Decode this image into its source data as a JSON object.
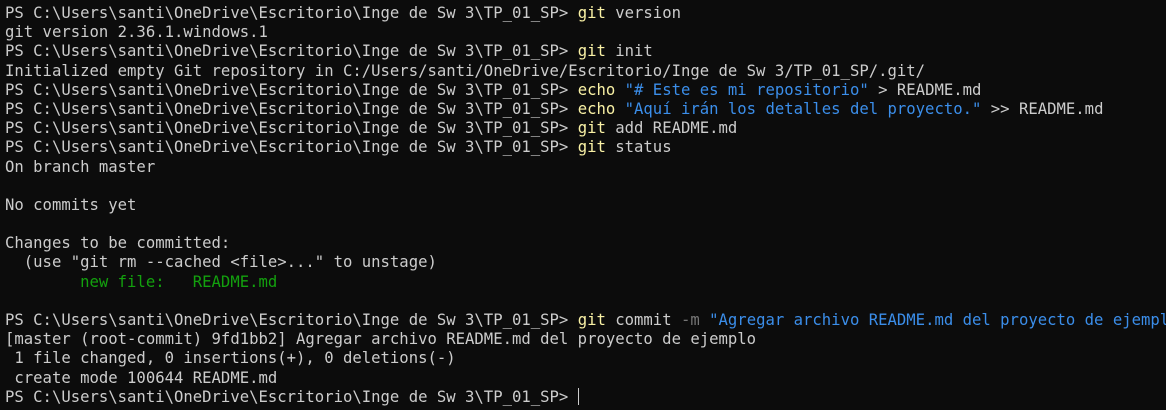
{
  "prompt": "PS C:\\Users\\santi\\OneDrive\\Escritorio\\Inge de Sw 3\\TP_01_SP> ",
  "lines": {
    "l1": {
      "cmd": "git",
      "arg": " version"
    },
    "l2": "git version 2.36.1.windows.1",
    "l3": {
      "cmd": "git",
      "arg": " init"
    },
    "l4": "Initialized empty Git repository in C:/Users/santi/OneDrive/Escritorio/Inge de Sw 3/TP_01_SP/.git/",
    "l5": {
      "cmd": "echo",
      "str": " \"# Este es mi repositorio\"",
      "rest": " > README.md"
    },
    "l6": {
      "cmd": "echo",
      "str": " \"Aquí irán los detalles del proyecto.\"",
      "rest": " >> README.md"
    },
    "l7": {
      "cmd": "git",
      "arg": " add README.md"
    },
    "l8": {
      "cmd": "git",
      "arg": " status"
    },
    "l9": "On branch master",
    "l11": "No commits yet",
    "l13": "Changes to be committed:",
    "l14": "  (use \"git rm --cached <file>...\" to unstage)",
    "l15": "        new file:   README.md",
    "l17": {
      "cmd": "git",
      "arg": " commit",
      "flag": " -m",
      "str": " \"Agregar archivo README.md del proyecto de ejemplo\""
    },
    "l18": "[master (root-commit) 9fd1bb2] Agregar archivo README.md del proyecto de ejemplo",
    "l19": " 1 file changed, 0 insertions(+), 0 deletions(-)",
    "l20": " create mode 100644 README.md"
  }
}
